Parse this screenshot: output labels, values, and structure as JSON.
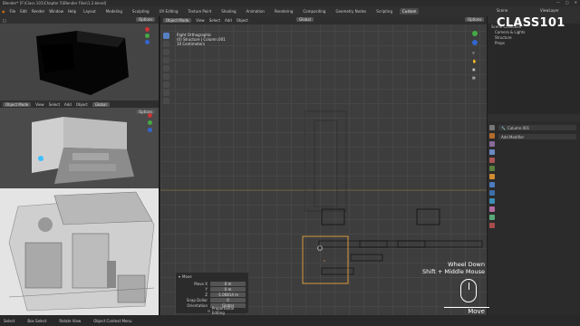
{
  "window": {
    "title": "Blender* [F:\\Class 101\\Chapter 5\\Blender Files\\1.2.blend]"
  },
  "menu": {
    "items": [
      "File",
      "Edit",
      "Render",
      "Window",
      "Help"
    ],
    "workspaces": [
      "Layout",
      "Modeling",
      "Sculpting",
      "UV Editing",
      "Texture Paint",
      "Shading",
      "Animation",
      "Rendering",
      "Compositing",
      "Geometry Nodes",
      "Scripting",
      "Custom"
    ],
    "active_workspace": "Custom",
    "scene": "Scene",
    "view_layer": "ViewLayer"
  },
  "viewport_main": {
    "mode": "Object Mode",
    "menus": [
      "View",
      "Select",
      "Add",
      "Object"
    ],
    "transform": "Global",
    "options": "Options",
    "overlay_line1": "Right Orthographic",
    "overlay_line2": "(0) Structure | Column.001",
    "overlay_line3": "10 Centimeters"
  },
  "viewport_tl": {
    "options": "Options"
  },
  "viewport_ml": {
    "mode": "Object Mode",
    "menus": [
      "View",
      "Select",
      "Add",
      "Object"
    ],
    "transform": "Global",
    "options": "Options"
  },
  "outliner": {
    "rows": [
      "Scene Collection",
      "Camera & Lights",
      "Structure",
      "Props"
    ]
  },
  "properties": {
    "object_name": "Column.001",
    "add_modifier": "Add Modifier"
  },
  "operator_panel": {
    "title": "Move",
    "labels": {
      "move_x": "Move X",
      "y": "Y",
      "z": "Z",
      "snap": "Snap Dollar",
      "orientation": "Orientation"
    },
    "values": {
      "x": "0 m",
      "y": "0 m",
      "z": "-1.06814 m",
      "snap": "0",
      "orientation": "Global"
    },
    "proportional": "Proportional Editing"
  },
  "brand": {
    "logo": "CLASS101"
  },
  "key_overlay": {
    "line1": "Wheel Down",
    "line2": "Shift + Middle Mouse",
    "action": "Move"
  },
  "statusbar": {
    "items": [
      "Select",
      "Box Select",
      "Rotate View",
      "Object Context Menu"
    ]
  }
}
